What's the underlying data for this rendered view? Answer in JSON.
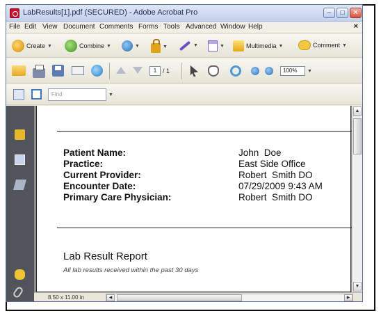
{
  "window": {
    "title": "LabResults[1].pdf (SECURED) - Adobe Acrobat Pro"
  },
  "menu": [
    "File",
    "Edit",
    "View",
    "Document",
    "Comments",
    "Forms",
    "Tools",
    "Advanced",
    "Window",
    "Help"
  ],
  "toolbar1": {
    "create": "Create",
    "combine": "Combine",
    "multimedia": "Multimedia",
    "comment": "Comment"
  },
  "toolbar2": {
    "page_current": "1",
    "page_total": "/ 1",
    "zoom": "100%"
  },
  "toolbar3": {
    "find_placeholder": "Find"
  },
  "document": {
    "fields": [
      {
        "label": "Patient Name:",
        "value": "John  Doe"
      },
      {
        "label": "Practice:",
        "value": "East Side Office"
      },
      {
        "label": "Current Provider:",
        "value": "Robert  Smith DO"
      },
      {
        "label": "Encounter Date:",
        "value": "07/29/2009 9:43 AM"
      },
      {
        "label": "Primary Care Physician:",
        "value": "Robert  Smith DO"
      }
    ],
    "report_title": "Lab Result Report",
    "report_subtitle": "All lab results received within the past  30 days"
  },
  "status": {
    "page_size": "8.50 x 11.00 in"
  },
  "colors": {
    "titlebar": "#c4d1ec",
    "sidebar": "#51545a",
    "close": "#d4533f"
  }
}
